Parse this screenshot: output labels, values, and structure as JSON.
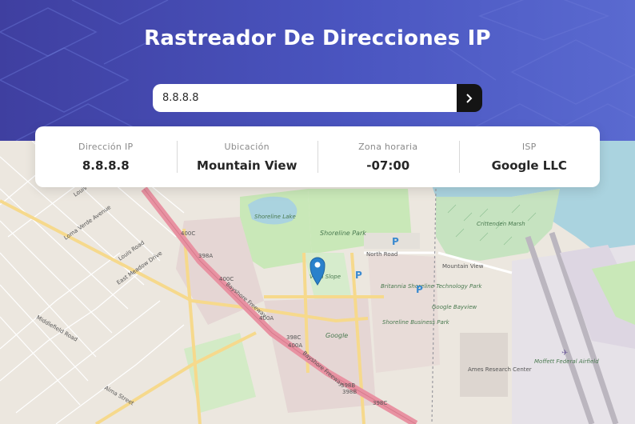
{
  "header": {
    "title": "Rastreador De Direcciones IP"
  },
  "search": {
    "value": "8.8.8.8",
    "submit_icon": "chevron-right-icon"
  },
  "info": {
    "ip_label": "Dirección IP",
    "ip_value": "8.8.8.8",
    "location_label": "Ubicación",
    "location_value": "Mountain View",
    "timezone_label": "Zona horaria",
    "timezone_value": "-07:00",
    "isp_label": "ISP",
    "isp_value": "Google LLC"
  },
  "map": {
    "marker_icon": "location-pin-icon",
    "labels": {
      "shoreline_lake": "Shoreline Lake",
      "shoreline_park": "Shoreline Park",
      "vista_slope": "Vista Slope",
      "north_road": "North Road",
      "britannia": "Britannia Shoreline Technology Park",
      "shoreline_business": "Shoreline Business Park",
      "google": "Google",
      "google_bayview": "Google Bayview",
      "crittenden_marsh": "Crittenden Marsh",
      "mountain_view_road": "Mountain View",
      "ames": "Ames Research Center",
      "moffett": "Moffett Federal Airfield",
      "bayshore_freeway": "Bayshore Freeway",
      "louis_road": "Louis Road",
      "loma_verde": "Loma Verde Avenue",
      "east_meadow": "East Meadow Drive",
      "middlefield": "Middlefield Road",
      "alma": "Alma Street",
      "r400c_1": "400C",
      "r400c_2": "400C",
      "r398a": "398A",
      "r400a_1": "400A",
      "r400a_2": "400A",
      "r398c": "398C",
      "r398b": "398B",
      "r398b_2": "398B",
      "r398c_2": "398C"
    },
    "colors": {
      "land": "#ece7df",
      "park": "#c9e8b8",
      "water": "#aad3df",
      "highway": "#e892a2",
      "primary": "#fcd6a4",
      "marker": "#2a81cb"
    }
  }
}
